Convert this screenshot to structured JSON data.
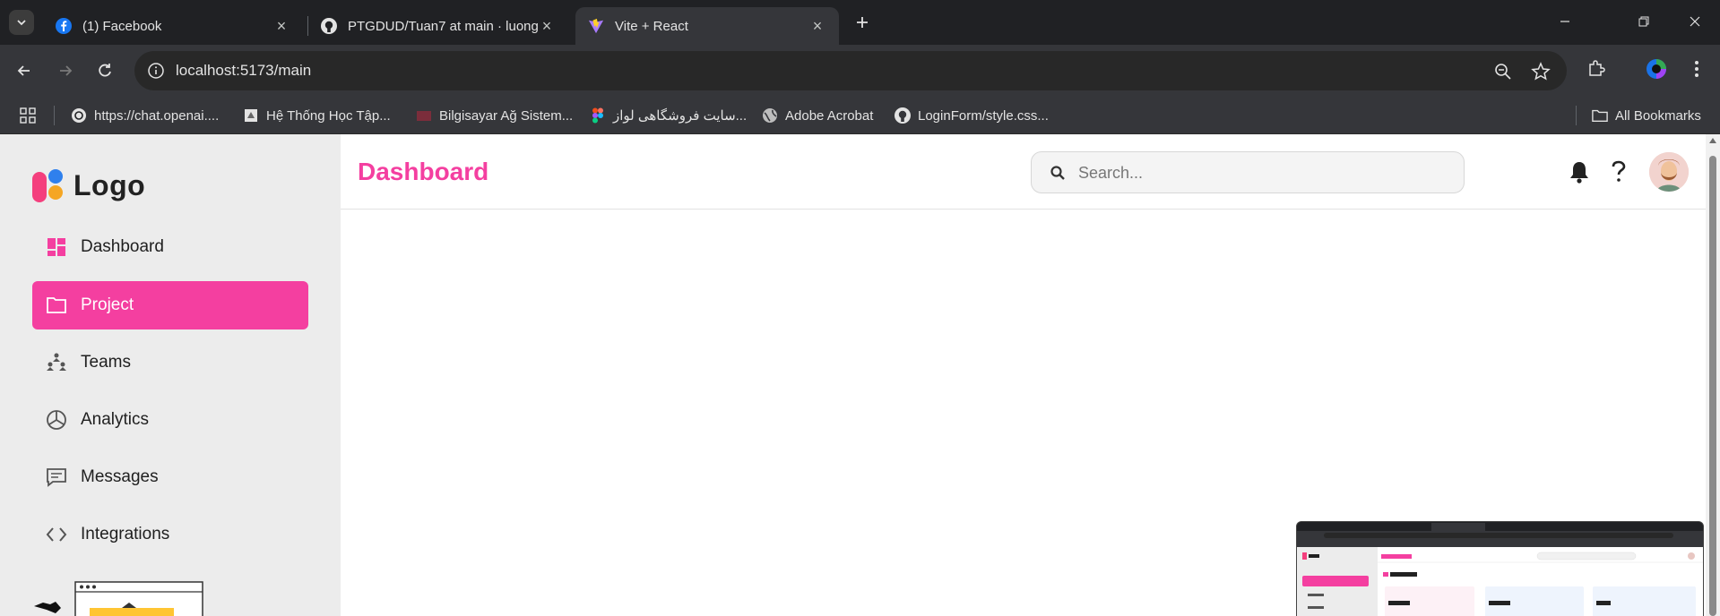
{
  "browser": {
    "tabs": [
      {
        "title": "(1) Facebook",
        "icon": "facebook-icon",
        "active": false
      },
      {
        "title": "PTGDUD/Tuan7 at main · luong",
        "icon": "github-icon",
        "active": false
      },
      {
        "title": "Vite + React",
        "icon": "vite-icon",
        "active": true
      }
    ],
    "url": "localhost:5173/main",
    "bookmarks": [
      {
        "label": "https://chat.openai....",
        "icon": "openai-icon"
      },
      {
        "label": "Hệ Thống Học Tập...",
        "icon": "school-icon"
      },
      {
        "label": "Bilgisayar Ağ Sistem...",
        "icon": "folder-icon"
      },
      {
        "label": "سایت فروشگاهی لواز...",
        "icon": "figma-icon"
      },
      {
        "label": "Adobe Acrobat",
        "icon": "globe-icon"
      },
      {
        "label": "LoginForm/style.css...",
        "icon": "github-icon"
      }
    ],
    "all_bookmarks": "All Bookmarks"
  },
  "app": {
    "logo_text": "Logo",
    "nav": [
      {
        "label": "Dashboard",
        "icon": "dashboard-icon",
        "active": false
      },
      {
        "label": "Project",
        "icon": "folder-icon",
        "active": true
      },
      {
        "label": "Teams",
        "icon": "teams-icon",
        "active": false
      },
      {
        "label": "Analytics",
        "icon": "analytics-icon",
        "active": false
      },
      {
        "label": "Messages",
        "icon": "messages-icon",
        "active": false
      },
      {
        "label": "Integrations",
        "icon": "code-icon",
        "active": false
      }
    ],
    "header": {
      "title": "Dashboard",
      "search_placeholder": "Search..."
    }
  },
  "colors": {
    "accent": "#f43fa0",
    "sidebar_bg": "#ececec",
    "browser_bg": "#202124",
    "toolbar_bg": "#35363a"
  }
}
